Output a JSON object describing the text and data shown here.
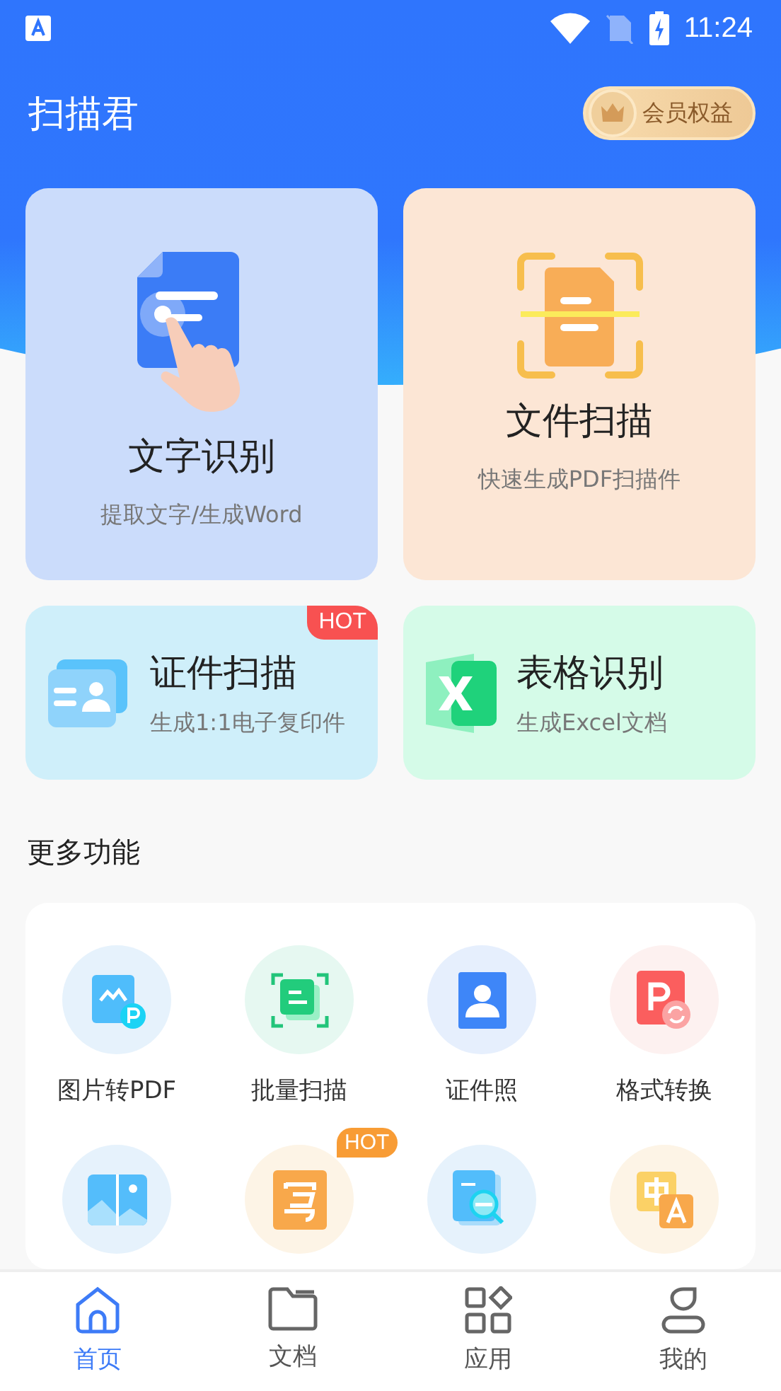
{
  "status_bar": {
    "time": "11:24"
  },
  "header": {
    "title": "扫描君",
    "vip_button": "会员权益"
  },
  "main_cards": [
    {
      "title": "文字识别",
      "subtitle": "提取文字/生成Word"
    },
    {
      "title": "文件扫描",
      "subtitle": "快速生成PDF扫描件"
    }
  ],
  "small_cards": [
    {
      "title": "证件扫描",
      "subtitle": "生成1:1电子复印件",
      "badge": "HOT"
    },
    {
      "title": "表格识别",
      "subtitle": "生成Excel文档"
    }
  ],
  "more_section": {
    "title": "更多功能",
    "hot_badge": "HOT",
    "tools": [
      {
        "label": "图片转PDF",
        "hot": false
      },
      {
        "label": "批量扫描",
        "hot": false
      },
      {
        "label": "证件照",
        "hot": false
      },
      {
        "label": "格式转换",
        "hot": false
      },
      {
        "hot": false
      },
      {
        "hot": true
      },
      {
        "hot": false
      },
      {
        "hot": false
      }
    ]
  },
  "bottom_nav": [
    {
      "label": "首页",
      "selected": true
    },
    {
      "label": "文档",
      "selected": false
    },
    {
      "label": "应用",
      "selected": false
    },
    {
      "label": "我的",
      "selected": false
    }
  ]
}
